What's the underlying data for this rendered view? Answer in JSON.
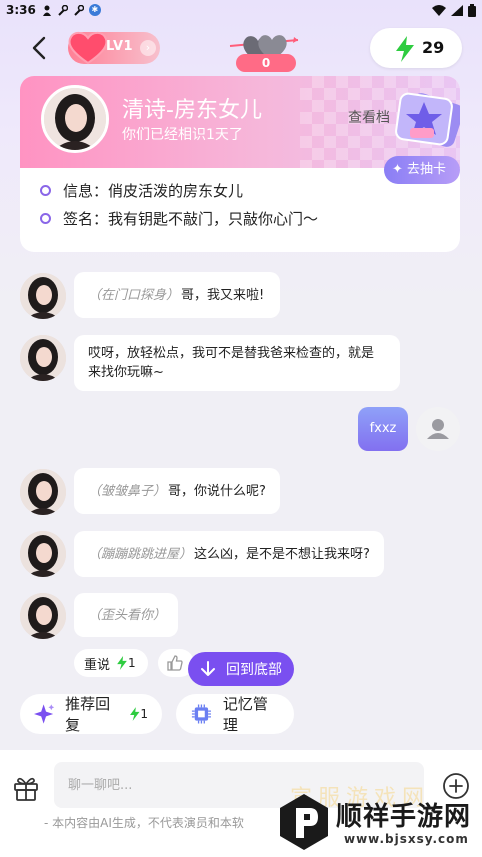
{
  "status_bar": {
    "time": "3:36"
  },
  "header": {
    "level": "LV1",
    "hearts_count": "0",
    "energy": "29"
  },
  "character": {
    "name": "清诗-房东女儿",
    "days_known": "你们已经相识1天了",
    "view_archive": "查看档",
    "draw_card": "去抽卡",
    "info_label": "信息：",
    "info_value": "俏皮活泼的房东女儿",
    "sign_label": "签名：",
    "sign_value": "我有钥匙不敲门，只敲你心门～"
  },
  "messages": [
    {
      "from": "ai",
      "action": "（在门口探身）",
      "text": "哥，我又来啦!"
    },
    {
      "from": "ai",
      "action": "",
      "text": "哎呀，放轻松点，我可不是替我爸来检查的，就是来找你玩嘛~"
    },
    {
      "from": "user",
      "action": "",
      "text": "fxxz"
    },
    {
      "from": "ai",
      "action": "（皱皱鼻子）",
      "text": "哥，你说什么呢?"
    },
    {
      "from": "ai",
      "action": "（蹦蹦跳跳进屋）",
      "text": "这么凶，是不是不想让我来呀?"
    },
    {
      "from": "ai",
      "action": "（歪头看你）",
      "text": ""
    }
  ],
  "message_actions": {
    "retry_label": "重说",
    "retry_cost": "1"
  },
  "scroll_to_bottom": "回到底部",
  "tools": {
    "suggest_reply": "推荐回复",
    "suggest_cost": "1",
    "memory": "记忆管理"
  },
  "composer": {
    "placeholder": "聊一聊吧...",
    "disclaimer": "- 本内容由AI生成，不代表演员和本软"
  },
  "watermark": {
    "title": "顺祥手游网",
    "url": "www.bjsxsy.com",
    "faded": "宣服游戏网"
  },
  "colors": {
    "accent": "#7a4ff0",
    "user_bubble": "#8270f0",
    "energy": "#2ecc40",
    "heart": "#ff6b86"
  }
}
